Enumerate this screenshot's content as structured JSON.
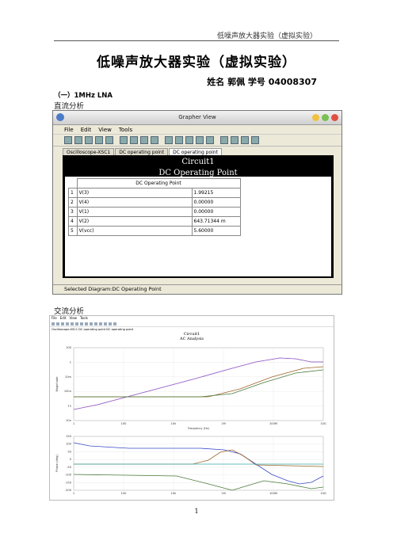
{
  "header": {
    "running_title": "低噪声放大器实验（虚拟实验）",
    "page_number": "1"
  },
  "doc": {
    "title": "低噪声放大器实验（虚拟实验）",
    "author_line": "姓名 郭佩    学号 04008307",
    "section": "（一）1MHz LNA",
    "dc_heading": "直流分析",
    "ac_heading": "交流分析"
  },
  "grapher": {
    "window_title": "Grapher View",
    "menu": [
      "File",
      "Edit",
      "View",
      "Tools"
    ],
    "tabs": [
      "Oscilloscope-XSC1",
      "DC operating point",
      "DC operating point"
    ],
    "plot_title_1": "Circuit1",
    "plot_title_2": "DC Operating Point",
    "table_header": "DC Operating Point",
    "rows": [
      {
        "n": "1",
        "name": "V(3)",
        "value": "1.99215"
      },
      {
        "n": "2",
        "name": "V(4)",
        "value": "0.00000"
      },
      {
        "n": "3",
        "name": "V(1)",
        "value": "0.00000"
      },
      {
        "n": "4",
        "name": "V(2)",
        "value": "643.71344 m"
      },
      {
        "n": "5",
        "name": "V(vcc)",
        "value": "5.60000"
      }
    ],
    "status": "Selected Diagram:DC Operating Point"
  },
  "ac": {
    "menu": [
      "File",
      "Edit",
      "View",
      "Tools"
    ],
    "tabs": [
      "Oscilloscope-XSC1",
      "DC operating point",
      "DC operating point"
    ],
    "title1": "Circuit1",
    "title2": "AC Analysis",
    "ylabel_mag": "Magnitude",
    "ylabel_phase": "Phase (deg)",
    "xlabel": "Frequency (Hz)",
    "xticks": [
      "1",
      "100",
      "10k",
      "1M",
      "100M",
      "10G"
    ],
    "mag_yticks": [
      "100",
      "1",
      "10m",
      "100u",
      "1u",
      "10n"
    ],
    "phase_yticks": [
      "150",
      "100",
      "50",
      "0",
      "-50",
      "-100",
      "-150",
      "-200"
    ],
    "colors": {
      "blue": "#3a49c9",
      "brown": "#a0652a",
      "green": "#4a7a3a",
      "cyan": "#36a8a8"
    }
  }
}
